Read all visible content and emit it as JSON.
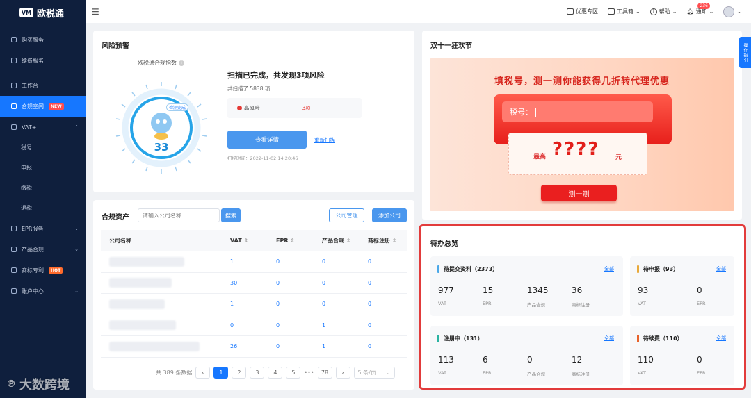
{
  "app": {
    "logo_mark": "VM",
    "logo_text": "欧税通"
  },
  "sidebar": {
    "items": [
      {
        "label": "购买服务"
      },
      {
        "label": "续费服务"
      },
      {
        "label": "工作台"
      },
      {
        "label": "合规空间",
        "badge": "NEW"
      },
      {
        "label": "VAT+"
      },
      {
        "label": "EPR服务"
      },
      {
        "label": "产品合规"
      },
      {
        "label": "商标专利",
        "badge": "HOT"
      },
      {
        "label": "账户中心"
      }
    ],
    "vat_sub": [
      "税号",
      "申报",
      "缴税",
      "退税"
    ]
  },
  "topbar": {
    "promo": "优惠专区",
    "tools": "工具箱",
    "help": "帮助",
    "notice": "通知",
    "notice_count": "236"
  },
  "risk": {
    "title": "风险预警",
    "index_label": "欧税通合规指数",
    "gauge_tag": "检测完成",
    "score": "33",
    "scan_title": "扫描已完成，共发现3项风险",
    "scan_sub": "共扫描了 5838 项",
    "high_label": "高风险",
    "high_count": "3项",
    "view_btn": "查看详情",
    "rescan": "重新扫描",
    "scan_time": "扫描时间：2022-11-02 14:20:46"
  },
  "assets": {
    "title": "合规资产",
    "search_placeholder": "请输入公司名称",
    "search_btn": "搜索",
    "manage_btn": "公司管理",
    "add_btn": "添加公司",
    "columns": [
      "公司名称",
      "VAT",
      "EPR",
      "产品合规",
      "商标注册"
    ],
    "rows": [
      [
        "",
        "1",
        "0",
        "0",
        "0"
      ],
      [
        "",
        "30",
        "0",
        "0",
        "0"
      ],
      [
        "",
        "1",
        "0",
        "0",
        "0"
      ],
      [
        "",
        "0",
        "0",
        "1",
        "0"
      ],
      [
        "",
        "26",
        "0",
        "1",
        "0"
      ]
    ],
    "pager": {
      "total": "共 389 条数据",
      "prev": "‹",
      "pages": [
        "1",
        "2",
        "3",
        "4",
        "5"
      ],
      "ellipsis": "•••",
      "last": "78",
      "next": "›",
      "size": "5 条/页"
    }
  },
  "promo": {
    "title": "双十一狂欢节",
    "headline": "填税号，测一测你能获得几折转代理优惠",
    "input_placeholder": "税号：",
    "prefix": "最高",
    "mark": "????",
    "suffix": "元",
    "btn": "测一测"
  },
  "guide": {
    "label": "操作指引"
  },
  "todo": {
    "title": "待办总览",
    "groups": [
      {
        "title": "待提交资料（2373）",
        "all": "全部",
        "color": "#4aa8e8",
        "stats": [
          {
            "v": "977",
            "l": "VAT"
          },
          {
            "v": "15",
            "l": "EPR"
          },
          {
            "v": "1345",
            "l": "产品合规"
          },
          {
            "v": "36",
            "l": "商标注册"
          }
        ]
      },
      {
        "title": "待申报（93）",
        "all": "全部",
        "color": "#e8a93a",
        "stats": [
          {
            "v": "93",
            "l": "VAT"
          },
          {
            "v": "0",
            "l": "EPR"
          }
        ]
      },
      {
        "title": "注册中（131）",
        "all": "全部",
        "color": "#2ab3a2",
        "stats": [
          {
            "v": "113",
            "l": "VAT"
          },
          {
            "v": "6",
            "l": "EPR"
          },
          {
            "v": "0",
            "l": "产品合规"
          },
          {
            "v": "12",
            "l": "商标注册"
          }
        ]
      },
      {
        "title": "待续费（110）",
        "all": "全部",
        "color": "#e8622a",
        "stats": [
          {
            "v": "110",
            "l": "VAT"
          },
          {
            "v": "0",
            "l": "EPR"
          }
        ]
      }
    ]
  },
  "watermark": {
    "text": "大数跨境"
  }
}
